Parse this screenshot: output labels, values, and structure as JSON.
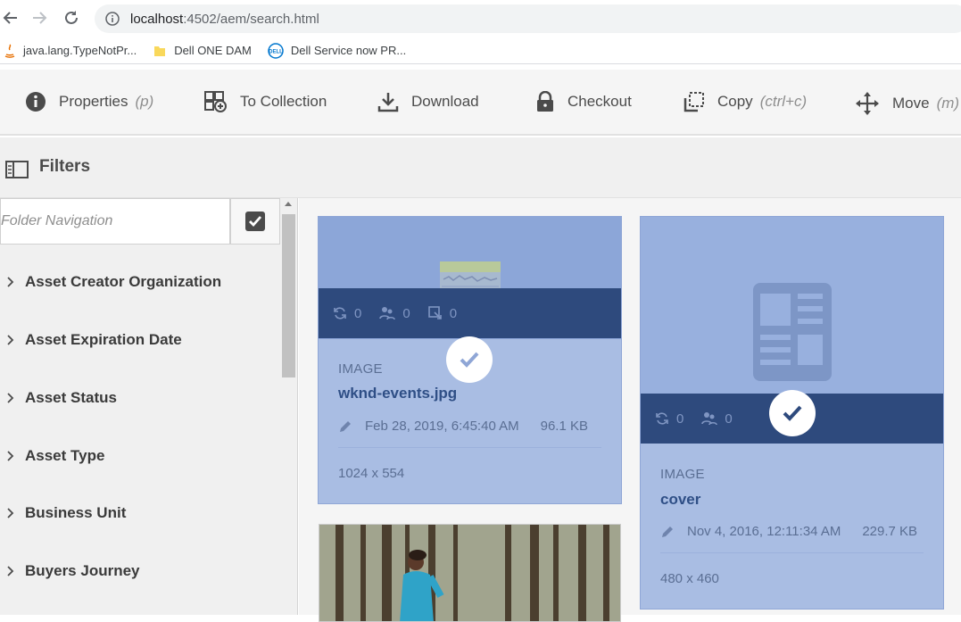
{
  "browser": {
    "url_host": "localhost",
    "url_path": ":4502/aem/search.html",
    "bookmarks": [
      {
        "label": "java.lang.TypeNotPr...",
        "icon": "java-icon"
      },
      {
        "label": "Dell ONE DAM",
        "icon": "folder-icon"
      },
      {
        "label": "Dell Service now PR...",
        "icon": "dell-icon"
      }
    ]
  },
  "actions": {
    "properties": {
      "label": "Properties",
      "shortcut": "(p)"
    },
    "collection": {
      "label": "To Collection"
    },
    "download": {
      "label": "Download"
    },
    "checkout": {
      "label": "Checkout"
    },
    "copy": {
      "label": "Copy",
      "shortcut": "(ctrl+c)"
    },
    "move": {
      "label": "Move",
      "shortcut": "(m)"
    }
  },
  "filters": {
    "title": "Filters",
    "folder_placeholder": "Folder Navigation",
    "facets": [
      "Asset Creator Organization",
      "Asset Expiration Date",
      "Asset Status",
      "Asset Type",
      "Business Unit",
      "Buyers Journey"
    ]
  },
  "cards": [
    {
      "type": "IMAGE",
      "name": "wknd-events.jpg",
      "date": "Feb 28, 2019, 6:45:40 AM",
      "size": "96.1 KB",
      "dimensions": "1024 x 554",
      "counts": [
        "0",
        "0",
        "0"
      ],
      "selected": true
    },
    {
      "type": "IMAGE",
      "name": "cover",
      "date": "Nov 4, 2016, 12:11:34 AM",
      "size": "229.7 KB",
      "dimensions": "480 x 460",
      "counts": [
        "0",
        "0"
      ],
      "selected": true
    }
  ],
  "colors": {
    "selected_card": "#a9bde3",
    "quick_action_bar": "#2e4a7d",
    "card_title": "#2f4f86"
  }
}
